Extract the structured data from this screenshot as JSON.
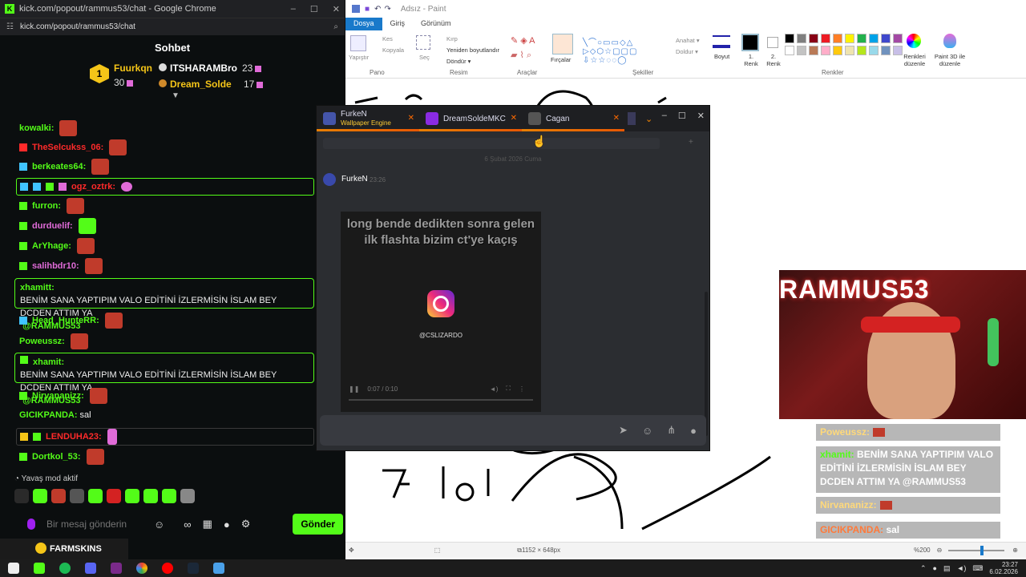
{
  "chrome": {
    "title": "kick.com/popout/rammus53/chat - Google Chrome",
    "url": "kick.com/popout/rammus53/chat"
  },
  "chat": {
    "header": "Sohbet",
    "leaderboard": [
      {
        "rank": "1",
        "name": "Fuurkqn",
        "score": "30",
        "color": "#f5c518"
      },
      {
        "rank": "",
        "name": "ITSHARAMBro",
        "score": "23",
        "color": "#ffffff"
      },
      {
        "rank": "",
        "name": "Dream_Solde",
        "score": "17",
        "color": "#f5c518"
      }
    ],
    "messages": [
      {
        "user": "kowalki:",
        "color": "#53fc18",
        "text": "",
        "boxed": false
      },
      {
        "user": "TheSelcukss_06:",
        "color": "#ff2a2a",
        "text": "",
        "boxed": false
      },
      {
        "user": "berkeates64:",
        "color": "#53fc18",
        "text": "",
        "boxed": false
      },
      {
        "user": "ogz_oztrk:",
        "color": "#ff2a2a",
        "text": "",
        "boxed": true
      },
      {
        "user": "furron:",
        "color": "#53fc18",
        "text": "",
        "boxed": false
      },
      {
        "user": "durduelif:",
        "color": "#e06bd8",
        "text": "",
        "boxed": false
      },
      {
        "user": "ArYhage:",
        "color": "#53fc18",
        "text": "",
        "boxed": false
      },
      {
        "user": "salihbdr10:",
        "color": "#e06bd8",
        "text": "",
        "boxed": false
      },
      {
        "user": "xhamitt:",
        "color": "#53fc18",
        "text": "BENİM SANA YAPTIPIM VALO EDİTİNİ İZLERMİSİN İSLAM BEY DCDEN ATTIM YA",
        "mention": "@RAMMUS53",
        "boxed": true
      },
      {
        "user": "Head_HunteRR:",
        "color": "#53fc18",
        "text": "",
        "boxed": false
      },
      {
        "user": "Poweussz:",
        "color": "#53fc18",
        "text": "",
        "boxed": false
      },
      {
        "user": "xhamit:",
        "color": "#53fc18",
        "text": "BENİM SANA YAPTIPIM VALO EDİTİNİ İZLERMİSİN İSLAM BEY DCDEN ATTIM YA",
        "mention": "@RAMMUS53",
        "boxed": true
      },
      {
        "user": "Nirvananizz:",
        "color": "#53fc18",
        "text": "",
        "boxed": false
      },
      {
        "user": "GICIKPANDA:",
        "color": "#53fc18",
        "text": "sal",
        "boxed": false
      },
      {
        "user": "LENDUHA23:",
        "color": "#ff2a2a",
        "text": "",
        "boxed": true
      },
      {
        "user": "Dortkol_53:",
        "color": "#53fc18",
        "text": "",
        "boxed": false
      }
    ],
    "slow_mode": "Yavaş mod aktif",
    "input_placeholder": "Bir mesaj gönderin",
    "send_label": "Gönder",
    "farmskins": "FARMSKINS"
  },
  "paint": {
    "title": "Adsız - Paint",
    "tabs": [
      "Dosya",
      "Giriş",
      "Görünüm"
    ],
    "groups": {
      "pano": "Pano",
      "resim": "Resim",
      "araclar": "Araçlar",
      "sekiller": "Şekiller",
      "renkler": "Renkler"
    },
    "items": {
      "yapistir": "Yapıştır",
      "kes": "Kes",
      "kopyala": "Kopyala",
      "sec": "Seç",
      "kirp": "Kırp",
      "yeniden": "Yeniden boyutlandır",
      "dondur": "Döndür ▾",
      "fircalar": "Fırçalar",
      "anahat": "Anahat ▾",
      "doldur": "Doldur ▾",
      "boyut": "Boyut",
      "renk1": "1. Renk",
      "renk2": "2. Renk",
      "renkleri_duzenle": "Renkleri düzenle",
      "paint3d": "Paint 3D ile düzenle"
    },
    "canvas_size": "1152 × 648px",
    "zoom": "%200",
    "palette": [
      "#000000",
      "#7f7f7f",
      "#880015",
      "#ed1c24",
      "#ff7f27",
      "#fff200",
      "#22b14c",
      "#00a2e8",
      "#3f48cc",
      "#a349a4",
      "#ffffff",
      "#c3c3c3",
      "#b97a57",
      "#ffaec9",
      "#ffc90e",
      "#efe4b0",
      "#b5e61d",
      "#99d9ea",
      "#7092be",
      "#c8bfe7"
    ]
  },
  "popout": {
    "tabs": [
      {
        "name": "FurkeN",
        "sub": "Wallpaper Engine"
      },
      {
        "name": "DreamSoldeMKC",
        "sub": ""
      },
      {
        "name": "Cagan",
        "sub": ""
      }
    ],
    "date_divider": "6 Şubat 2026 Cuma",
    "author": "FurkeN",
    "time": "23:26",
    "video_caption": "long bende dedikten sonra gelen ilk flashta bizim ct'ye kaçış",
    "ig_handle": "@CSLIZARDO",
    "video_time": "0:07 / 0:10"
  },
  "overlay": {
    "messages": [
      {
        "user": "Poweussz:",
        "text": ""
      },
      {
        "user": "xhamit:",
        "text": "BENİM SANA YAPTIPIM VALO EDİTİNİ İZLERMİSİN İSLAM BEY DCDEN ATTIM YA @RAMMUS53"
      },
      {
        "user": "Nirvananizz:",
        "text": ""
      },
      {
        "user": "GICIKPANDA:",
        "text": "sal"
      }
    ]
  },
  "webcam": {
    "banner": "RAMMUS53"
  },
  "taskbar": {
    "time": "23:27",
    "date": "6.02.2026"
  }
}
